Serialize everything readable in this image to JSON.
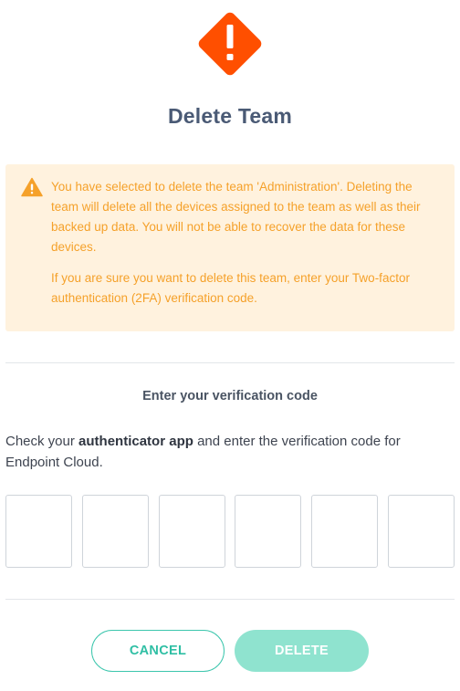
{
  "dialog": {
    "title": "Delete Team"
  },
  "warning": {
    "paragraph1": "You have selected to delete the team 'Administration'. Deleting the team will delete all the devices assigned to the team as well as their backed up data. You will not be able to recover the data for these devices.",
    "paragraph2": "If you are sure you want to delete this team, enter your Two-factor authentication (2FA) verification code."
  },
  "verification": {
    "heading": "Enter your verification code",
    "instruction_prefix": "Check your ",
    "instruction_bold": "authenticator app",
    "instruction_suffix": " and enter the verification code for Endpoint Cloud.",
    "code_digits": [
      "",
      "",
      "",
      "",
      "",
      ""
    ]
  },
  "buttons": {
    "cancel_label": "CANCEL",
    "delete_label": "DELETE"
  },
  "colors": {
    "danger_icon": "#ff4f00",
    "warning_text": "#f5a12a",
    "warning_bg": "#fff2de",
    "accent": "#3cc6ad",
    "accent_disabled": "#8fe3cf",
    "title": "#4a5a75"
  },
  "icons": {
    "hero": "exclamation-diamond-icon",
    "warning": "warning-triangle-icon"
  }
}
